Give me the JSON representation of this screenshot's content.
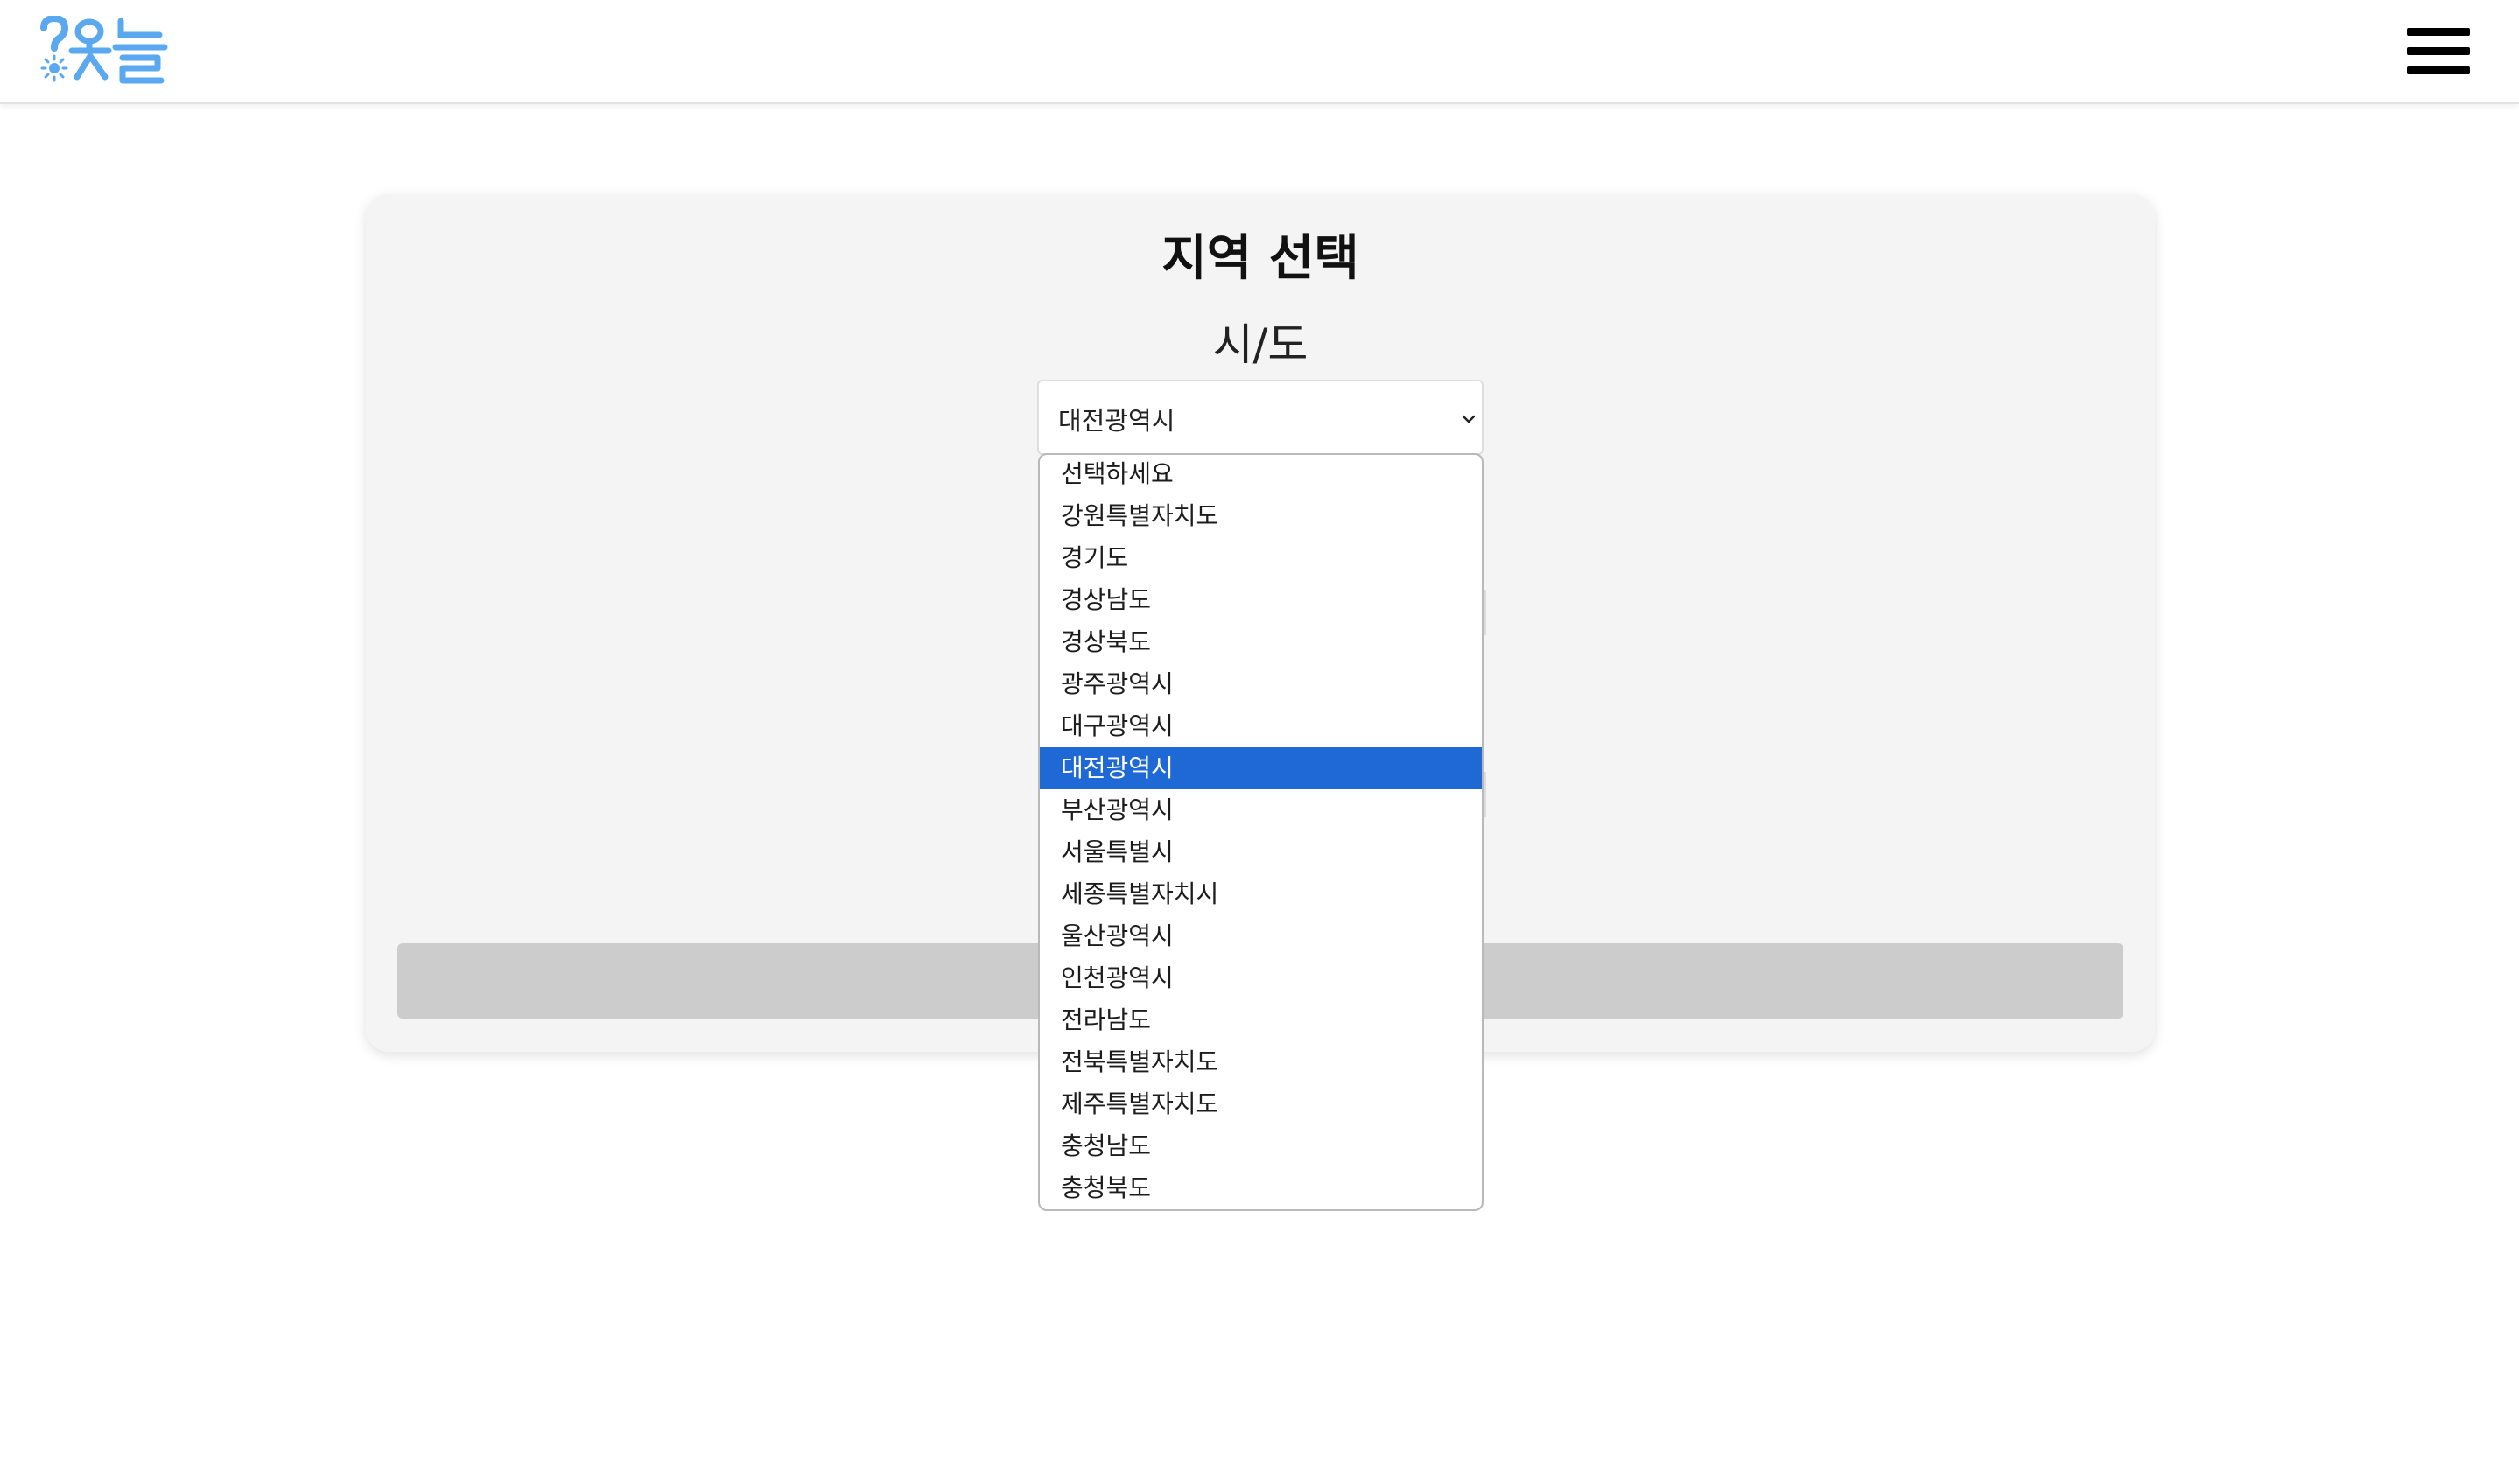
{
  "header": {
    "logo_text": "?옷늘",
    "menu_icon": "hamburger-menu-icon"
  },
  "card": {
    "title": "지역 선택",
    "field_label": "시/도",
    "select_value": "대전광역시"
  },
  "dropdown": {
    "selected_index": 7,
    "options": [
      "선택하세요",
      "강원특별자치도",
      "경기도",
      "경상남도",
      "경상북도",
      "광주광역시",
      "대구광역시",
      "대전광역시",
      "부산광역시",
      "서울특별시",
      "세종특별자치시",
      "울산광역시",
      "인천광역시",
      "전라남도",
      "전북특별자치도",
      "제주특별자치도",
      "충청남도",
      "충청북도"
    ]
  },
  "colors": {
    "logo": "#5aa9f0",
    "selected_option": "#1f69d6",
    "card_background": "#f4f4f4",
    "submit_bar": "#cccccc"
  }
}
